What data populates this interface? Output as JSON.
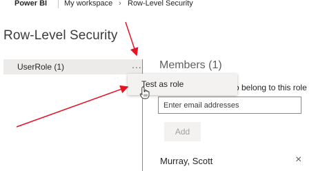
{
  "topbar": {
    "brand": "Power BI",
    "breadcrumb": [
      "My workspace",
      "Row-Level Security"
    ],
    "chevron": "›"
  },
  "page_title": "Row-Level Security",
  "roles": [
    {
      "label": "UserRole (1)",
      "more": "..."
    }
  ],
  "context_menu": {
    "items": [
      {
        "label": "Test as role"
      }
    ]
  },
  "members": {
    "title": "Members (1)",
    "description_visible": "o belong to this role",
    "input_placeholder": "Enter email addresses",
    "add_label": "Add",
    "list": [
      {
        "name": "Murray, Scott",
        "remove_icon": "×"
      }
    ]
  },
  "annotations": {
    "arrow_color": "#e81123"
  },
  "icons": {
    "cursor": "hand-pointer-icon",
    "remove": "close-icon",
    "more": "ellipsis-icon"
  }
}
